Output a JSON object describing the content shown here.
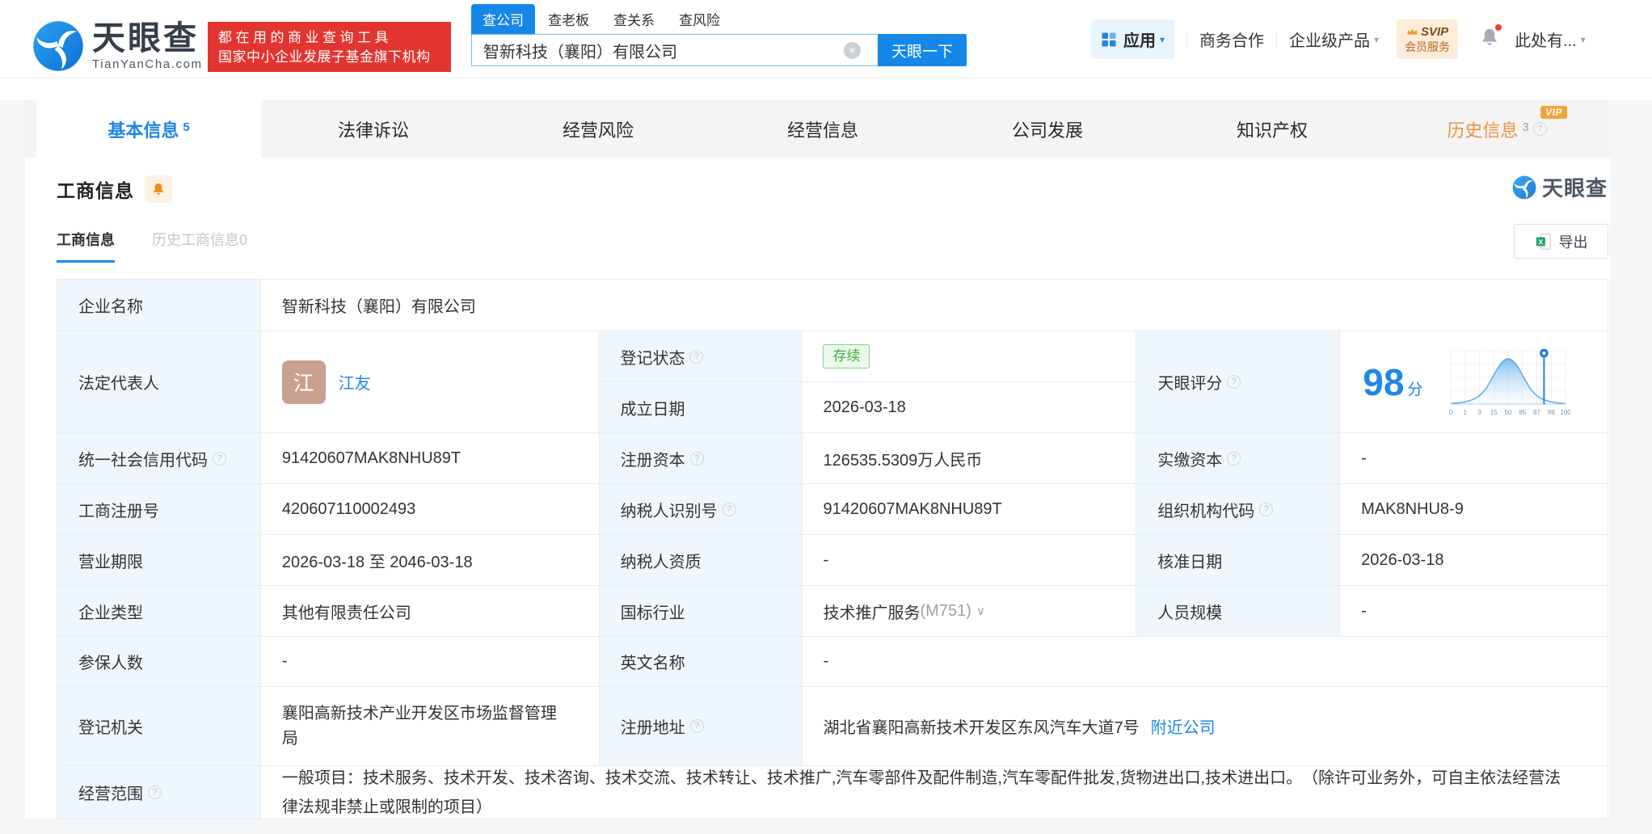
{
  "ui": {
    "help": "?",
    "caret": "▾",
    "chevron": "∨",
    "clear": "×",
    "vip": "VIP"
  },
  "header": {
    "logo": {
      "name": "天眼查",
      "domain": "TianYanCha.com"
    },
    "promo": {
      "line1": "都在用的商业查询工具",
      "line2": "国家中小企业发展子基金旗下机构"
    },
    "search": {
      "tabs": [
        {
          "label": "查公司",
          "active": true
        },
        {
          "label": "查老板",
          "active": false
        },
        {
          "label": "查关系",
          "active": false
        },
        {
          "label": "查风险",
          "active": false
        }
      ],
      "value": "智新科技（襄阳）有限公司",
      "button": "天眼一下"
    },
    "menu": {
      "apps": "应用",
      "cooperation": "商务合作",
      "enterprise": "企业级产品",
      "svip_line1": "SVIP",
      "svip_line2": "会员服务",
      "user": "此处有..."
    }
  },
  "nav": {
    "tabs": [
      {
        "label": "基本信息",
        "count": "5",
        "active": true
      },
      {
        "label": "法律诉讼",
        "count": "",
        "active": false
      },
      {
        "label": "经营风险",
        "count": "",
        "active": false
      },
      {
        "label": "经营信息",
        "count": "",
        "active": false
      },
      {
        "label": "公司发展",
        "count": "",
        "active": false
      },
      {
        "label": "知识产权",
        "count": "",
        "active": false
      },
      {
        "label": "历史信息",
        "count": "3",
        "active": false,
        "vip": true
      }
    ]
  },
  "section": {
    "title": "工商信息",
    "watermark": "天眼查",
    "subtabs": [
      {
        "label": "工商信息",
        "active": true
      },
      {
        "label": "历史工商信息0",
        "active": false
      }
    ],
    "export": "导出"
  },
  "company": {
    "name_label": "企业名称",
    "name": "智新科技（襄阳）有限公司",
    "legal_rep_label": "法定代表人",
    "legal_rep_avatar": "江",
    "legal_rep_name": "江友",
    "reg_status_label": "登记状态",
    "reg_status": "存续",
    "est_date_label": "成立日期",
    "est_date": "2026-03-18",
    "score_label": "天眼评分"
  },
  "fields": {
    "credit_code": {
      "label": "统一社会信用代码",
      "value": "91420607MAK8NHU89T"
    },
    "reg_capital": {
      "label": "注册资本",
      "value": "126535.5309万人民币"
    },
    "paid_capital": {
      "label": "实缴资本",
      "value": "-"
    },
    "reg_no": {
      "label": "工商注册号",
      "value": "420607110002493"
    },
    "taxpayer_id": {
      "label": "纳税人识别号",
      "value": "91420607MAK8NHU89T"
    },
    "org_code": {
      "label": "组织机构代码",
      "value": "MAK8NHU8-9"
    },
    "term": {
      "label": "营业期限",
      "value": "2026-03-18 至 2046-03-18"
    },
    "taxpayer_qualification": {
      "label": "纳税人资质",
      "value": "-"
    },
    "approved_date": {
      "label": "核准日期",
      "value": "2026-03-18"
    },
    "company_type": {
      "label": "企业类型",
      "value": "其他有限责任公司"
    },
    "industry": {
      "label": "国标行业",
      "value": "技术推广服务",
      "code": "(M751)"
    },
    "staff_size": {
      "label": "人员规模",
      "value": "-"
    },
    "insured_num": {
      "label": "参保人数",
      "value": "-"
    },
    "english_name": {
      "label": "英文名称",
      "value": "-"
    },
    "registry": {
      "label": "登记机关",
      "value": "襄阳高新技术产业开发区市场监督管理局"
    },
    "address": {
      "label": "注册地址",
      "value": "湖北省襄阳高新技术开发区东风汽车大道7号",
      "link": "附近公司"
    },
    "scope": {
      "label": "经营范围",
      "value": "一般项目：技术服务、技术开发、技术咨询、技术交流、技术转让、技术推广,汽车零部件及配件制造,汽车零配件批发,货物进出口,技术进出口。　（除许可业务外，可自主依法经营法律法规非禁止或限制的项目）"
    }
  },
  "chart_data": {
    "type": "area",
    "title": "天眼评分分布曲线",
    "score": "98",
    "score_unit": "分",
    "x_ticks": [
      "0",
      "1",
      "3",
      "15",
      "50",
      "85",
      "97",
      "99",
      "100"
    ],
    "marker_value": 98,
    "marker_fraction": 0.8125,
    "curve_points": [
      [
        0,
        0.01
      ],
      [
        0.06,
        0.02
      ],
      [
        0.125,
        0.045
      ],
      [
        0.19,
        0.09
      ],
      [
        0.25,
        0.17
      ],
      [
        0.31,
        0.33
      ],
      [
        0.37,
        0.6
      ],
      [
        0.43,
        0.86
      ],
      [
        0.5,
        1.0
      ],
      [
        0.57,
        0.86
      ],
      [
        0.63,
        0.6
      ],
      [
        0.69,
        0.33
      ],
      [
        0.75,
        0.17
      ],
      [
        0.81,
        0.09
      ],
      [
        0.875,
        0.045
      ],
      [
        0.94,
        0.02
      ],
      [
        1,
        0.01
      ]
    ],
    "grid": true,
    "ylim": [
      0,
      1
    ],
    "accent_color": "#1e87e8"
  }
}
